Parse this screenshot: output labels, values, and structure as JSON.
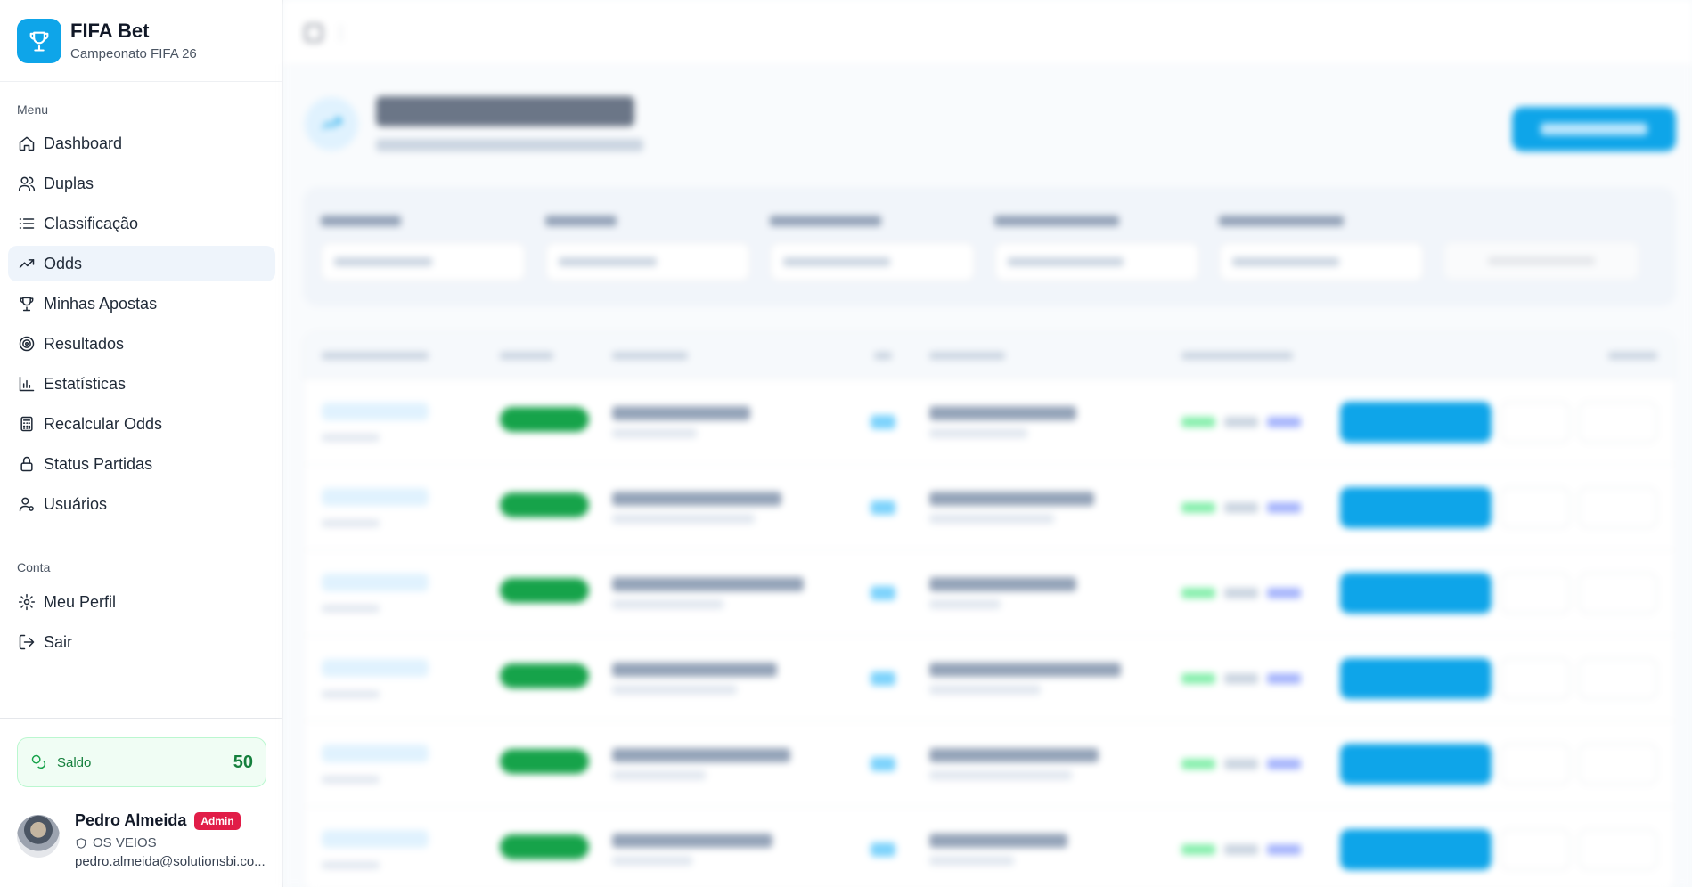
{
  "brand": {
    "title": "FIFA Bet",
    "subtitle": "Campeonato FIFA 26"
  },
  "sidebar": {
    "menu_label": "Menu",
    "items": [
      {
        "label": "Dashboard",
        "icon": "home-icon"
      },
      {
        "label": "Duplas",
        "icon": "users-icon"
      },
      {
        "label": "Classificação",
        "icon": "list-icon"
      },
      {
        "label": "Odds",
        "icon": "trending-up-icon",
        "active": true
      },
      {
        "label": "Minhas Apostas",
        "icon": "trophy-icon"
      },
      {
        "label": "Resultados",
        "icon": "target-icon"
      },
      {
        "label": "Estatísticas",
        "icon": "bar-chart-icon"
      },
      {
        "label": "Recalcular Odds",
        "icon": "calculator-icon"
      },
      {
        "label": "Status Partidas",
        "icon": "lock-icon"
      },
      {
        "label": "Usuários",
        "icon": "user-cog-icon"
      }
    ],
    "account_label": "Conta",
    "account_items": [
      {
        "label": "Meu Perfil",
        "icon": "gear-icon"
      },
      {
        "label": "Sair",
        "icon": "logout-icon"
      }
    ]
  },
  "balance": {
    "label": "Saldo",
    "value": "50"
  },
  "user": {
    "name": "Pedro Almeida",
    "role": "Admin",
    "team": "OS VEIOS",
    "email": "pedro.almeida@solutionsbi.co..."
  },
  "colors": {
    "accent": "#0ea5e9",
    "success": "#16a34a",
    "danger": "#e11d48"
  }
}
